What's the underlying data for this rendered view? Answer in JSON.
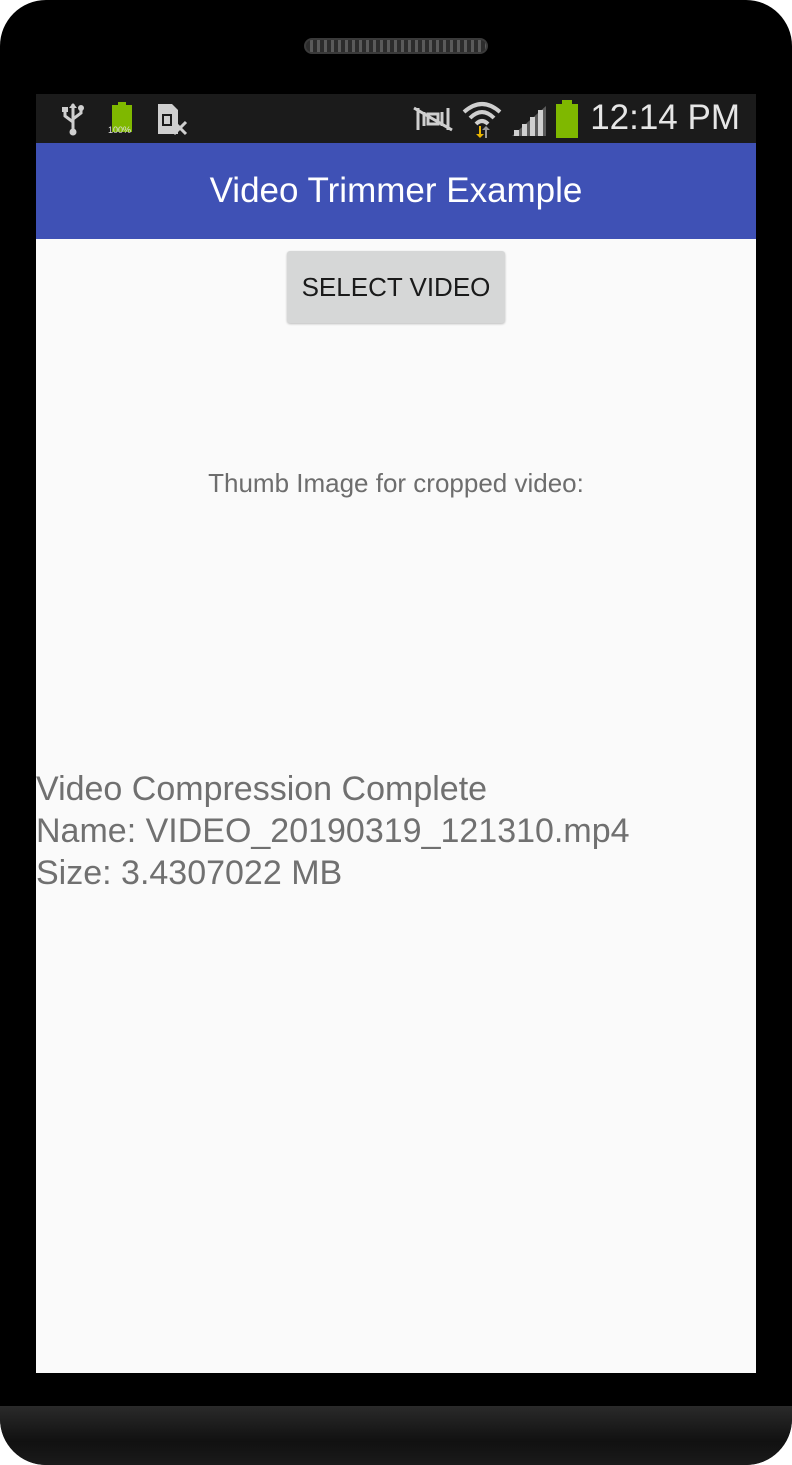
{
  "status_bar": {
    "time": "12:14 PM",
    "battery_small_label": "100%",
    "icons": [
      "usb-icon",
      "battery-full-icon",
      "sim-card-icon",
      "mute-icon",
      "wifi-icon",
      "signal-icon",
      "battery-icon"
    ],
    "battery_level": 1.0
  },
  "app_bar": {
    "title": "Video Trimmer Example",
    "color": "#3f51b5"
  },
  "main": {
    "select_button_label": "SELECT VIDEO",
    "thumb_label": "Thumb Image for cropped video:",
    "result_lines": [
      "Video Compression Complete",
      "Name: VIDEO_20190319_121310.mp4",
      "Size: 3.4307022 MB"
    ]
  }
}
